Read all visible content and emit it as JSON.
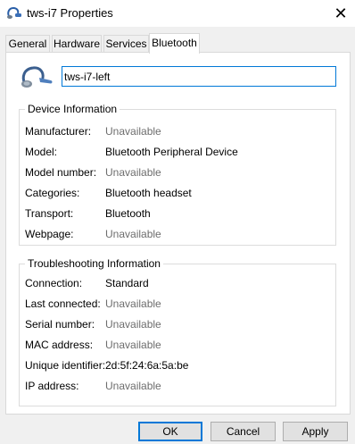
{
  "window": {
    "title": "tws-i7 Properties",
    "close_icon": "close-icon",
    "app_icon": "bluetooth-headset-icon"
  },
  "tabs": [
    {
      "label": "General",
      "active": false
    },
    {
      "label": "Hardware",
      "active": false
    },
    {
      "label": "Services",
      "active": false
    },
    {
      "label": "Bluetooth",
      "active": true
    }
  ],
  "device": {
    "icon": "bluetooth-headset-icon",
    "name_value": "tws-i7-left"
  },
  "device_info": {
    "title": "Device Information",
    "rows": [
      {
        "label": "Manufacturer:",
        "value": "Unavailable",
        "available": false
      },
      {
        "label": "Model:",
        "value": "Bluetooth Peripheral Device",
        "available": true
      },
      {
        "label": "Model number:",
        "value": "Unavailable",
        "available": false
      },
      {
        "label": "Categories:",
        "value": "Bluetooth headset",
        "available": true
      },
      {
        "label": "Transport:",
        "value": "Bluetooth",
        "available": true
      },
      {
        "label": "Webpage:",
        "value": "Unavailable",
        "available": false
      }
    ]
  },
  "troubleshooting": {
    "title": "Troubleshooting Information",
    "rows": [
      {
        "label": "Connection:",
        "value": "Standard",
        "available": true
      },
      {
        "label": "Last connected:",
        "value": "Unavailable",
        "available": false
      },
      {
        "label": "Serial number:",
        "value": "Unavailable",
        "available": false
      },
      {
        "label": "MAC address:",
        "value": "Unavailable",
        "available": false
      },
      {
        "label": "Unique identifier:",
        "value": "2d:5f:24:6a:5a:be",
        "available": true
      },
      {
        "label": "IP address:",
        "value": "Unavailable",
        "available": false
      }
    ]
  },
  "buttons": {
    "ok": "OK",
    "cancel": "Cancel",
    "apply": "Apply"
  },
  "colors": {
    "accent": "#0078d7",
    "unavailable_text": "#6d6d6d"
  }
}
